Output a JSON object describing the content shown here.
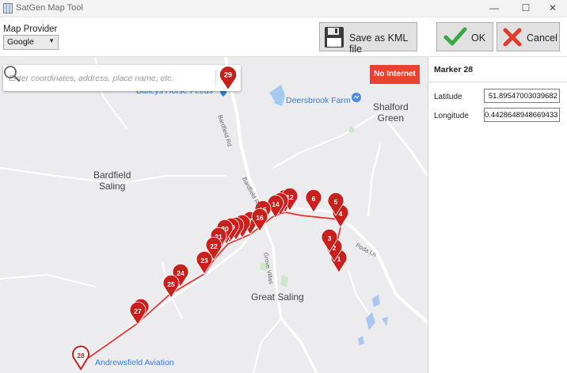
{
  "window": {
    "title": "SatGen Map Tool",
    "minimize_glyph": "—",
    "maximize_glyph": "☐",
    "close_glyph": "✕"
  },
  "toolbar": {
    "provider_label": "Map Provider",
    "provider_value": "Google",
    "save_kml_label": "Save as KML file",
    "ok_label": "OK",
    "cancel_label": "Cancel"
  },
  "map": {
    "search_placeholder": "Enter coordinates, address, place name, etc.",
    "search_marker_number": "29",
    "no_internet_label": "No Internet",
    "places": {
      "bardfield_saling": "Bardfield\nSaling",
      "shalford_green": "Shalford\nGreen",
      "great_saling": "Great Saling",
      "baileys": "Baileys Horse Feeds",
      "deersbrook": "Deersbrook Farm",
      "andrewsfield": "Andrewsfield Aviation"
    },
    "roads": {
      "bardfield_rd_1": "Bardfield Rd",
      "bardfield_rd_2": "Bardfield Rd",
      "grove_villas": "Grove Villas",
      "poda_ln": "Poda Ln"
    },
    "markers": [
      {
        "n": "1"
      },
      {
        "n": "2"
      },
      {
        "n": "3"
      },
      {
        "n": "4"
      },
      {
        "n": "5"
      },
      {
        "n": "6"
      },
      {
        "n": "7"
      },
      {
        "n": "8"
      },
      {
        "n": "9"
      },
      {
        "n": "10"
      },
      {
        "n": "11"
      },
      {
        "n": "12"
      },
      {
        "n": "13"
      },
      {
        "n": "14"
      },
      {
        "n": "15"
      },
      {
        "n": "16"
      },
      {
        "n": "17"
      },
      {
        "n": "18"
      },
      {
        "n": "19"
      },
      {
        "n": "20"
      },
      {
        "n": "21"
      },
      {
        "n": "22"
      },
      {
        "n": "23"
      },
      {
        "n": "24"
      },
      {
        "n": "25"
      },
      {
        "n": "26"
      },
      {
        "n": "27"
      },
      {
        "n": "28",
        "selected": true
      }
    ],
    "route_color": "#e8312b",
    "marker_color": "#c8201c"
  },
  "panel": {
    "title": "Marker 28",
    "latitude_label": "Latitude",
    "latitude_value": "51.89547003039682",
    "longitude_label": "Longitude",
    "longitude_value": "0.44286489486694336"
  }
}
